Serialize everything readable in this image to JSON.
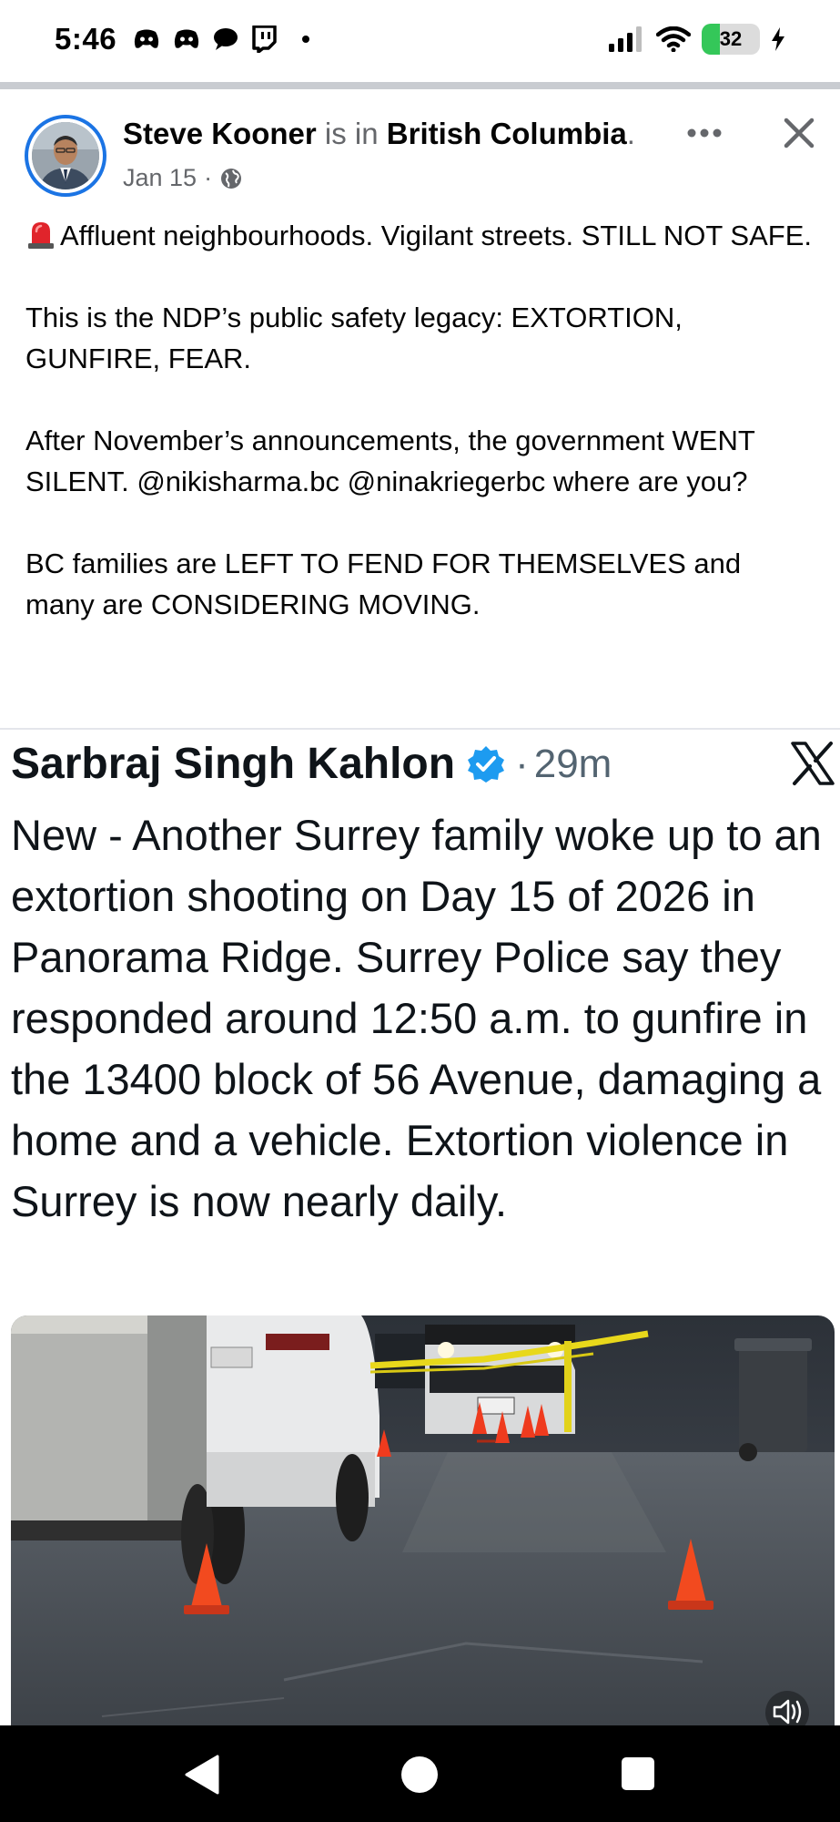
{
  "status_bar": {
    "time": "5:46",
    "battery_level": "32",
    "icons": [
      "discord-icon",
      "discord-icon",
      "chat-bubble-icon",
      "twitch-icon",
      "notification-dot",
      "signal-icon",
      "wifi-icon",
      "battery-icon",
      "charging-icon"
    ]
  },
  "post": {
    "author_name": "Steve Kooner",
    "connector": " is in ",
    "location": "British Columbia",
    "trailing_period": ".",
    "date": "Jan 15",
    "date_separator": " · ",
    "privacy_icon": "globe-icon",
    "paragraphs": [
      "Affluent neighbourhoods. Vigilant streets. STILL NOT SAFE.",
      "This is the NDP’s public safety legacy: EXTORTION, GUNFIRE, FEAR.",
      "After November’s announcements, the government WENT SILENT. @nikisharma.bc @ninakriegerbc where are you?",
      "BC families are LEFT TO FEND FOR THEMSELVES and many are CONSIDERING MOVING."
    ],
    "lead_emoji": "police-siren-icon"
  },
  "tweet": {
    "author": "Sarbraj Singh Kahlon",
    "separator": "·",
    "time": "29m",
    "text": "New - Another Surrey family woke up to an extortion shooting on Day 15 of 2026 in Panorama Ridge. Surrey Police say they responded around 12:50 a.m. to gunfire in the 13400 block of 56 Avenue, damaging a home and a vehicle. Extortion violence in Surrey is now nearly daily.",
    "verified_color": "#1d9bf0",
    "platform_icon": "x-logo-icon"
  },
  "colors": {
    "accent": "#1b74e4",
    "secondary_text": "#65676b",
    "primary_text": "#050505",
    "battery_green": "#34c759"
  }
}
